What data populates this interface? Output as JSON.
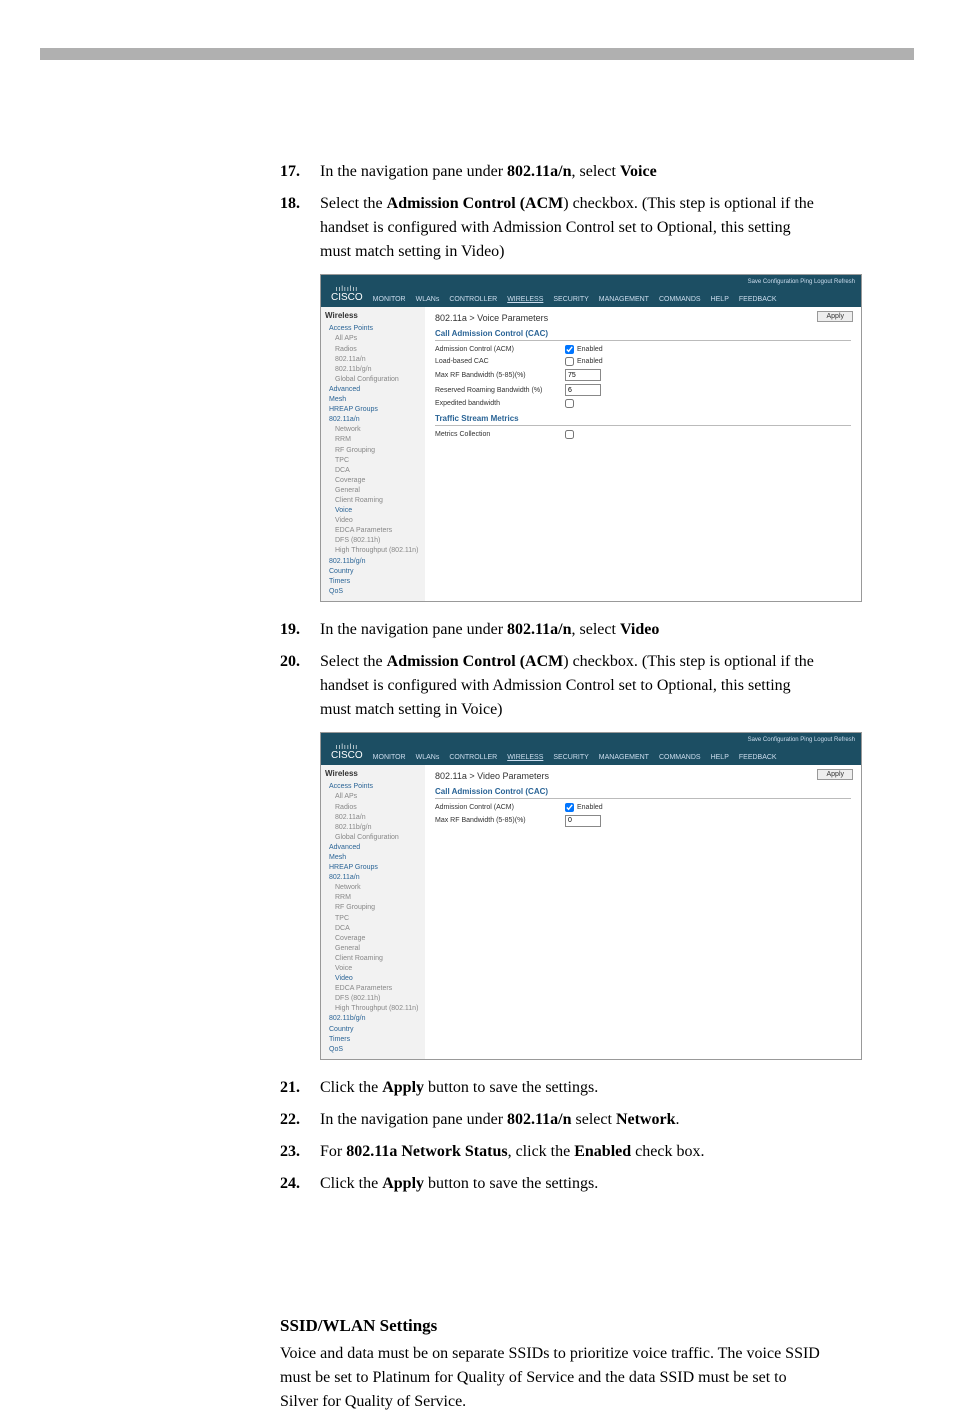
{
  "steps": {
    "s17": {
      "num": "17.",
      "a": "In the navigation pane under ",
      "b": "802.11a/n",
      "c": ", select ",
      "d": "Voice"
    },
    "s18": {
      "num": "18.",
      "a": "Select the ",
      "b": "Admission Control",
      "c": " (",
      "d": "ACM",
      "e": ") checkbox. (This step is optional if the handset is configured with Admission Control set to Optional, this setting must match setting in Video)"
    },
    "s19": {
      "num": "19.",
      "a": "In the navigation pane under ",
      "b": "802.11a/n",
      "c": ", select ",
      "d": "Video"
    },
    "s20": {
      "num": "20.",
      "a": "Select the ",
      "b": "Admission Control",
      "c": " (",
      "d": "ACM",
      "e": ") checkbox. (This step is optional if the handset is configured with Admission Control set to Optional, this setting must match setting in Voice)"
    },
    "s21": {
      "num": "21.",
      "a": "Click the ",
      "b": "Apply",
      "c": " button to save the settings."
    },
    "s22": {
      "num": "22.",
      "a": "In the navigation pane under ",
      "b": "802.11a/n",
      "c": " select ",
      "d": "Network",
      "e": "."
    },
    "s23": {
      "num": "23.",
      "a": "For ",
      "b": "802.11a Network Status",
      "c": ", click the ",
      "d": "Enabled",
      "e": " check box."
    },
    "s24": {
      "num": "24.",
      "a": "Click the ",
      "b": "Apply",
      "c": " button to save the settings."
    }
  },
  "ssid": {
    "title": "SSID/WLAN Settings",
    "a": "Voice and data must be on separate SSIDs to prioritize voice traffic. The voice SSID must be set to ",
    "b": "Platinum",
    "c": " for ",
    "d": "Quality of Service",
    "e": " and the data SSID must be set to ",
    "f": "Silver",
    "g": " for ",
    "h": "Quality of Service",
    "i": "."
  },
  "sc": {
    "logo_bars": "ıılıılıı",
    "logo": "CISCO",
    "toplinks": "Save Configuration   Ping   Logout  Refresh",
    "menu": [
      "MONITOR",
      "WLANs",
      "CONTROLLER",
      "WIRELESS",
      "SECURITY",
      "MANAGEMENT",
      "COMMANDS",
      "HELP",
      "FEEDBACK"
    ],
    "apply": "Apply",
    "sidebar_head": "Wireless",
    "side": [
      "Access Points",
      "All APs",
      "Radios",
      "802.11a/n",
      "802.11b/g/n",
      "Global Configuration",
      "Advanced",
      "Mesh",
      "HREAP Groups",
      "802.11a/n",
      "Network",
      "RRM",
      "RF Grouping",
      "TPC",
      "DCA",
      "Coverage",
      "General",
      "Client Roaming",
      "Voice",
      "Video",
      "EDCA Parameters",
      "DFS (802.11h)",
      "High Throughput (802.11n)",
      "802.11b/g/n",
      "Country",
      "Timers",
      "QoS"
    ],
    "voice": {
      "title": "802.11a > Voice Parameters",
      "cac": "Call Admission Control (CAC)",
      "acm": "Admission Control (ACM)",
      "acm_chk": "Enabled",
      "load": "Load-based CAC",
      "load_chk": "Enabled",
      "maxrf": "Max RF Bandwidth (5-85)(%)",
      "maxrf_val": "75",
      "roam": "Reserved Roaming Bandwidth (%)",
      "roam_val": "6",
      "exp": "Expedited bandwidth",
      "tsm": "Traffic Stream Metrics",
      "metrics": "Metrics Collection"
    },
    "video": {
      "title": "802.11a > Video Parameters",
      "cac": "Call Admission Control (CAC)",
      "acm": "Admission Control (ACM)",
      "acm_chk": "Enabled",
      "maxrf": "Max RF Bandwidth (5-85)(%)",
      "maxrf_val": "0"
    }
  }
}
